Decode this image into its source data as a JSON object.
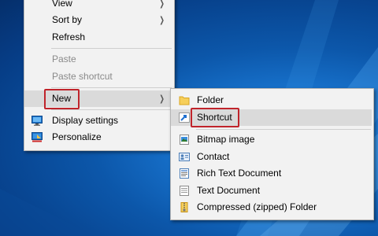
{
  "context_menu": {
    "items": {
      "view": "View",
      "sort_by": "Sort by",
      "refresh": "Refresh",
      "paste": "Paste",
      "paste_shortcut": "Paste shortcut",
      "new": "New",
      "display_settings": "Display settings",
      "personalize": "Personalize"
    }
  },
  "new_submenu": {
    "items": {
      "folder": "Folder",
      "shortcut": "Shortcut",
      "bitmap_image": "Bitmap image",
      "contact": "Contact",
      "rich_text_document": "Rich Text Document",
      "text_document": "Text Document",
      "compressed_folder": "Compressed (zipped) Folder"
    }
  },
  "icons": {
    "submenu_arrow": "chevron-right-icon",
    "display_settings": "display-settings-icon",
    "personalize": "personalize-icon",
    "folder": "folder-icon",
    "shortcut": "shortcut-icon",
    "bitmap_image": "bitmap-image-icon",
    "contact": "contact-icon",
    "rich_text_document": "rich-text-document-icon",
    "text_document": "text-document-icon",
    "compressed_folder": "zip-folder-icon"
  },
  "colors": {
    "menu_background": "#f2f2f2",
    "highlight": "#dadada",
    "annotation_red": "#c0242b",
    "disabled_text": "#8a8a8a",
    "desktop_blue": "#0c57aa"
  }
}
